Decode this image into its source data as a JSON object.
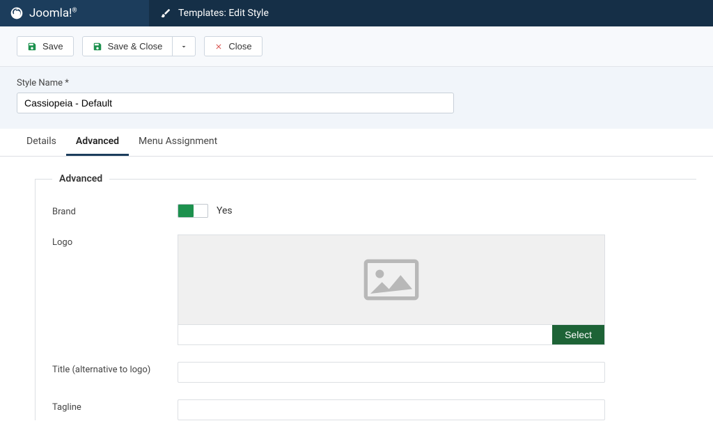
{
  "brand": "Joomla!",
  "page_title": "Templates: Edit Style",
  "toolbar": {
    "save": "Save",
    "save_close": "Save & Close",
    "close": "Close"
  },
  "style_name": {
    "label": "Style Name *",
    "value": "Cassiopeia - Default"
  },
  "tabs": {
    "details": "Details",
    "advanced": "Advanced",
    "menu_assignment": "Menu Assignment"
  },
  "fieldset": {
    "legend": "Advanced",
    "brand": {
      "label": "Brand",
      "value_text": "Yes"
    },
    "logo": {
      "label": "Logo",
      "select": "Select"
    },
    "title": {
      "label": "Title (alternative to logo)"
    },
    "tagline": {
      "label": "Tagline"
    }
  }
}
